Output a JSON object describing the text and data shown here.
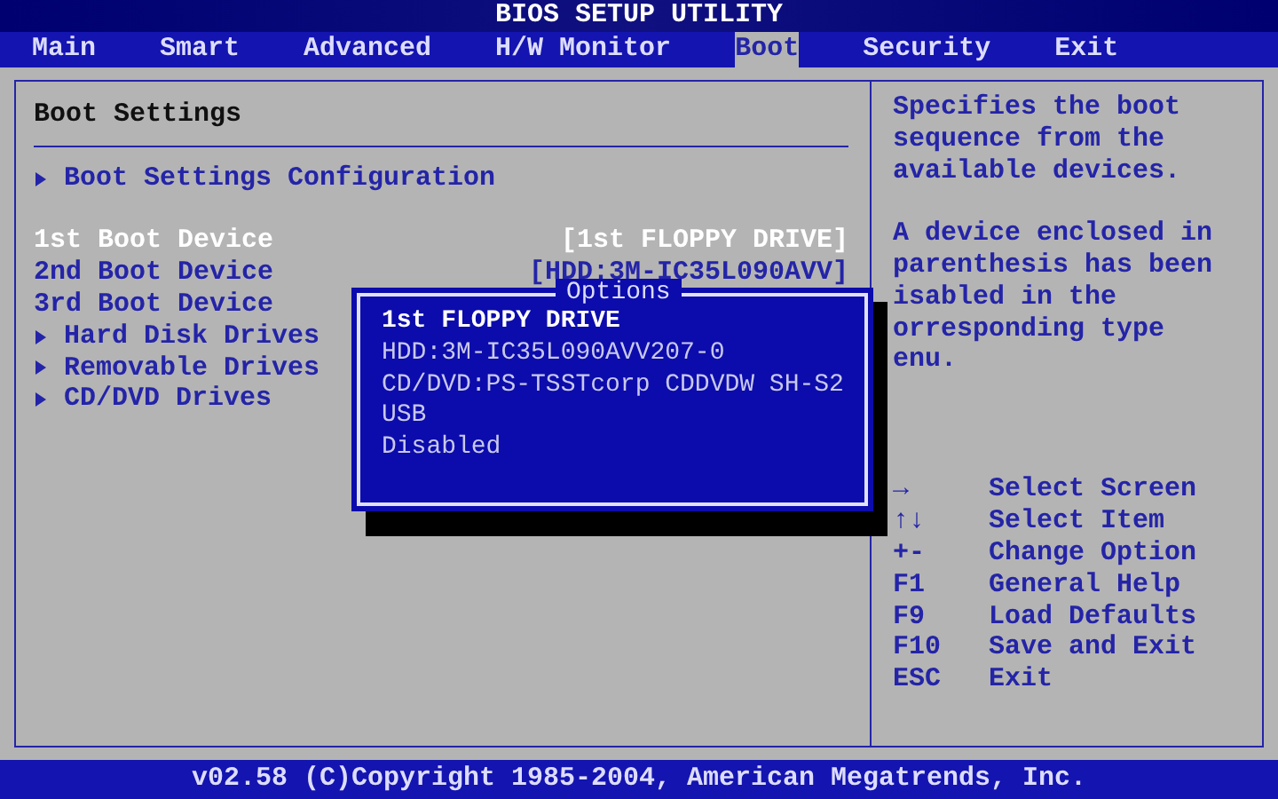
{
  "title": "BIOS SETUP UTILITY",
  "tabs": [
    {
      "label": "Main",
      "selected": false
    },
    {
      "label": "Smart",
      "selected": false
    },
    {
      "label": "Advanced",
      "selected": false
    },
    {
      "label": "H/W Monitor",
      "selected": false
    },
    {
      "label": "Boot",
      "selected": true
    },
    {
      "label": "Security",
      "selected": false
    },
    {
      "label": "Exit",
      "selected": false
    }
  ],
  "panel": {
    "heading": "Boot Settings",
    "items": [
      {
        "kind": "submenu",
        "label": "Boot Settings Configuration"
      },
      {
        "kind": "gap"
      },
      {
        "kind": "setting",
        "label": "1st Boot Device",
        "value": "[1st FLOPPY DRIVE]",
        "selected": true
      },
      {
        "kind": "setting",
        "label": "2nd Boot Device",
        "value": "[HDD:3M-IC35L090AVV]",
        "selected": false
      },
      {
        "kind": "setting",
        "label": "3rd Boot Device",
        "selected": false
      },
      {
        "kind": "submenu",
        "label": "Hard Disk Drives"
      },
      {
        "kind": "submenu",
        "label": "Removable Drives"
      },
      {
        "kind": "submenu",
        "label": "CD/DVD Drives"
      }
    ]
  },
  "popup": {
    "title": "Options",
    "options": [
      {
        "label": "1st FLOPPY DRIVE",
        "selected": true
      },
      {
        "label": "HDD:3M-IC35L090AVV207-0",
        "selected": false
      },
      {
        "label": "CD/DVD:PS-TSSTcorp CDDVDW SH-S2",
        "selected": false
      },
      {
        "label": "USB",
        "selected": false
      },
      {
        "label": "Disabled",
        "selected": false
      }
    ]
  },
  "help": {
    "paragraphs": [
      [
        "Specifies the boot",
        "sequence from the",
        "available devices."
      ],
      [
        "A device enclosed in",
        "parenthesis has been",
        "isabled in the",
        "orresponding type",
        "enu."
      ]
    ],
    "keys": [
      {
        "key": "→",
        "action": "Select Screen"
      },
      {
        "key": "↑↓",
        "action": "Select Item"
      },
      {
        "key": "+-",
        "action": "Change Option"
      },
      {
        "key": "F1",
        "action": "General Help"
      },
      {
        "key": "F9",
        "action": "Load Defaults"
      },
      {
        "key": "F10",
        "action": "Save and Exit"
      },
      {
        "key": "ESC",
        "action": "Exit"
      }
    ]
  },
  "footer": "v02.58 (C)Copyright 1985-2004, American Megatrends, Inc."
}
